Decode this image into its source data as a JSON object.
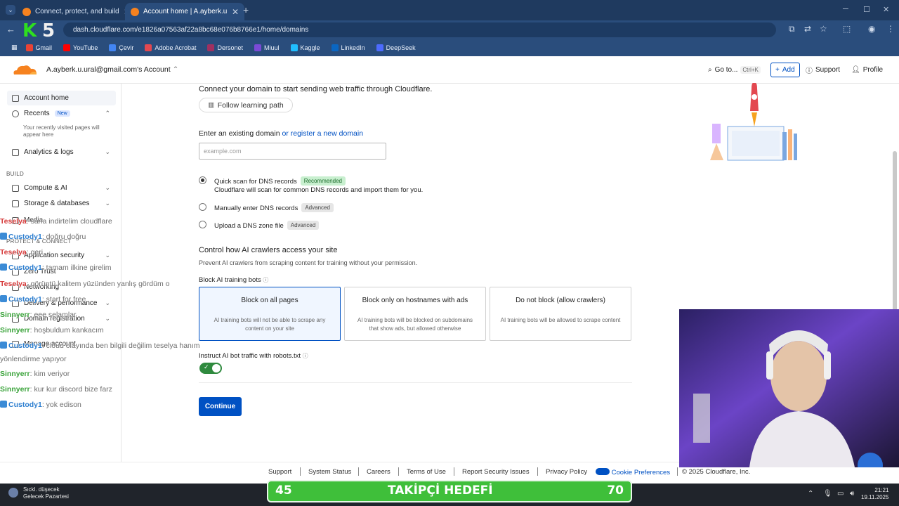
{
  "browser": {
    "tabs": [
      {
        "label": "Connect, protect, and build eve",
        "active": false
      },
      {
        "label": "Account home | A.ayberk.u.ural",
        "active": true
      }
    ],
    "url": "dash.cloudflare.com/e1826a07563af22a8bc68e076b8766e1/home/domains",
    "bookmarks": [
      {
        "label": "Gmail",
        "color": "#ea4335"
      },
      {
        "label": "YouTube",
        "color": "#ff0000"
      },
      {
        "label": "Çevir",
        "color": "#4285f4"
      },
      {
        "label": "Adobe Acrobat",
        "color": "#e34850"
      },
      {
        "label": "Dersonet",
        "color": "#a03060"
      },
      {
        "label": "Miuul",
        "color": "#7b4ad6"
      },
      {
        "label": "Kaggle",
        "color": "#20beff"
      },
      {
        "label": "LinkedIn",
        "color": "#0a66c2"
      },
      {
        "label": "DeepSeek",
        "color": "#4d6bfe"
      }
    ],
    "overlay_logo": {
      "k": "K",
      "five": "5"
    }
  },
  "header": {
    "account": "A.ayberk.u.ural@gmail.com's Account",
    "goto": "Go to...",
    "goto_shortcut": "Ctrl+K",
    "add": "Add",
    "support": "Support",
    "profile": "Profile"
  },
  "sidebar": {
    "account_home": "Account home",
    "recents": "Recents",
    "recents_badge": "New",
    "recents_hint": "Your recently visited pages will appear here",
    "analytics": "Analytics & logs",
    "build_label": "BUILD",
    "compute": "Compute & AI",
    "storage": "Storage & databases",
    "media": "Media",
    "protect_label": "PROTECT & CONNECT",
    "app_security": "Application security",
    "zero_trust": "Zero Trust",
    "networking": "Networking",
    "delivery": "Delivery & performance",
    "domain_reg": "Domain registration",
    "manage_account": "Manage account"
  },
  "chat": [
    {
      "user": "Teselya",
      "msg": ": sana indirtelim cloudflare",
      "color": "#d63a3a"
    },
    {
      "user": "Custody1",
      "msg": ": doğru doğru",
      "color": "#2e7fd0"
    },
    {
      "user": "Teselya",
      "msg": ": geri",
      "color": "#d63a3a"
    },
    {
      "user": "Custody1",
      "msg": ": tamam ilkine girelim",
      "color": "#2e7fd0"
    },
    {
      "user": "Teselya",
      "msg": ": görüntü kalitem yüzünden yanlış gördüm o",
      "color": "#d63a3a"
    },
    {
      "user": "Custody1",
      "msg": ": start for free",
      "color": "#2e7fd0"
    },
    {
      "user": "Sinnyerr",
      "msg": ": eee selamlar",
      "color": "#3aa33a"
    },
    {
      "user": "Sinnyerr",
      "msg": ": hoşbuldum kankacım",
      "color": "#3aa33a"
    },
    {
      "user": "Custody1",
      "msg": ": cloud olayında ben bilgili değilim teselya hanım",
      "color": "#2e7fd0"
    },
    {
      "user": "",
      "msg": "yönlendirme yapıyor",
      "color": "#6d6d6d"
    },
    {
      "user": "Sinnyerr",
      "msg": ": kim veriyor",
      "color": "#3aa33a"
    },
    {
      "user": "Sinnyerr",
      "msg": ": kur kur discord bize farz",
      "color": "#3aa33a"
    },
    {
      "user": "Custody1",
      "msg": ": yok edison",
      "color": "#2e7fd0"
    }
  ],
  "main": {
    "intro": "Connect your domain to start sending web traffic through Cloudflare.",
    "learning_path": "Follow learning path",
    "enter_domain": "Enter an existing domain",
    "register_link": "or register a new domain",
    "domain_placeholder": "example.com",
    "options": [
      {
        "label": "Quick scan for DNS records",
        "badge": "Recommended",
        "desc": "Cloudflare will scan for common DNS records and import them for you.",
        "selected": true
      },
      {
        "label": "Manually enter DNS records",
        "badge": "Advanced",
        "selected": false
      },
      {
        "label": "Upload a DNS zone file",
        "badge": "Advanced",
        "selected": false
      }
    ],
    "ai_title": "Control how AI crawlers access your site",
    "ai_desc": "Prevent AI crawlers from scraping content for training without your permission.",
    "block_label": "Block AI training bots",
    "cards": [
      {
        "title": "Block on all pages",
        "desc": "AI training bots will not be able to scrape any content on your site",
        "selected": true
      },
      {
        "title": "Block only on hostnames with ads",
        "desc": "AI training bots will be blocked on subdomains that show ads, but allowed otherwise",
        "selected": false
      },
      {
        "title": "Do not block (allow crawlers)",
        "desc": "AI training bots will be allowed to scrape content",
        "selected": false
      }
    ],
    "robots_label": "Instruct AI bot traffic with robots.txt",
    "robots_on": true,
    "continue": "Continue"
  },
  "footer": {
    "links": [
      "Support",
      "System Status",
      "Careers",
      "Terms of Use",
      "Report Security Issues",
      "Privacy Policy"
    ],
    "cookie": "Cookie Preferences",
    "copyright": "© 2025 Cloudflare, Inc."
  },
  "taskbar": {
    "weather_line1": "Sıckl. düşecek",
    "weather_line2": "Gelecek Pazartesi",
    "goal_left": "45",
    "goal_center": "TAKİPÇİ HEDEFİ",
    "goal_right": "70",
    "time": "21:21",
    "date": "19.11.2025"
  },
  "colors": {
    "accent": "#0051c3",
    "cloudflare_orange": "#f6821f",
    "toggle_on": "#2f8a3e"
  }
}
